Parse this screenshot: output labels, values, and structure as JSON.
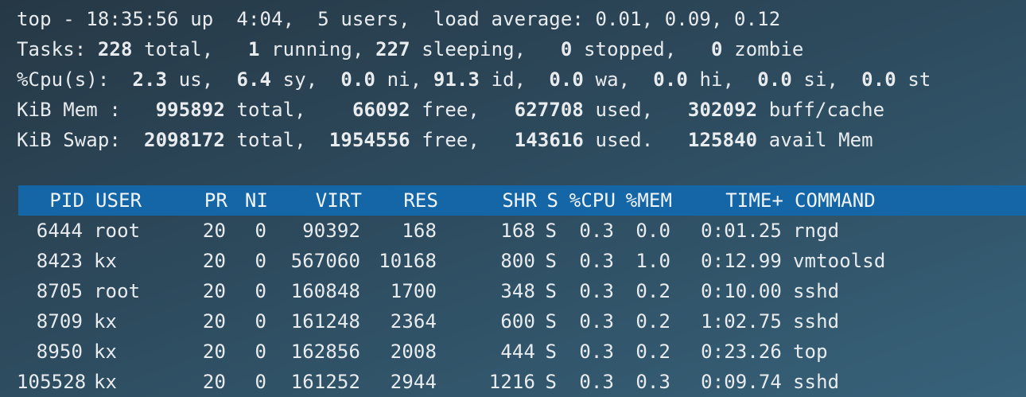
{
  "summary": {
    "line1": "top - 18:35:56 up  4:04,  5 users,  load average: 0.01, 0.09, 0.12",
    "tasks": {
      "prefix": "Tasks: ",
      "total": "228",
      "total_label": " total,   ",
      "running": "1",
      "running_label": " running, ",
      "sleeping": "227",
      "sleeping_label": " sleeping,   ",
      "stopped": "0",
      "stopped_label": " stopped,   ",
      "zombie": "0",
      "zombie_label": " zombie"
    },
    "cpu": {
      "prefix": "%Cpu(s):  ",
      "us": "2.3",
      "us_label": " us,  ",
      "sy": "6.4",
      "sy_label": " sy,  ",
      "ni": "0.0",
      "ni_label": " ni, ",
      "id": "91.3",
      "id_label": " id,  ",
      "wa": "0.0",
      "wa_label": " wa,  ",
      "hi": "0.0",
      "hi_label": " hi,  ",
      "si": "0.0",
      "si_label": " si,  ",
      "st": "0.0",
      "st_label": " st"
    },
    "mem": {
      "prefix": "KiB Mem :   ",
      "total": "995892",
      "total_label": " total,    ",
      "free": "66092",
      "free_label": " free,   ",
      "used": "627708",
      "used_label": " used,   ",
      "buff": "302092",
      "buff_label": " buff/cache"
    },
    "swap": {
      "prefix": "KiB Swap:  ",
      "total": "2098172",
      "total_label": " total,  ",
      "free": "1954556",
      "free_label": " free,   ",
      "used": "143616",
      "used_label": " used.   ",
      "avail": "125840",
      "avail_label": " avail Mem"
    }
  },
  "columns": {
    "pid": "PID",
    "user": "USER",
    "pr": "PR",
    "ni": "NI",
    "virt": "VIRT",
    "res": "RES",
    "shr": "SHR",
    "s": "S",
    "cpu": "%CPU",
    "mem": "%MEM",
    "time": "TIME+",
    "command": "COMMAND"
  },
  "processes": [
    {
      "pid": "6444",
      "user": "root",
      "pr": "20",
      "ni": "0",
      "virt": "90392",
      "res": "168",
      "shr": "168",
      "s": "S",
      "cpu": "0.3",
      "mem": "0.0",
      "time": "0:01.25",
      "command": "rngd"
    },
    {
      "pid": "8423",
      "user": "kx",
      "pr": "20",
      "ni": "0",
      "virt": "567060",
      "res": "10168",
      "shr": "800",
      "s": "S",
      "cpu": "0.3",
      "mem": "1.0",
      "time": "0:12.99",
      "command": "vmtoolsd"
    },
    {
      "pid": "8705",
      "user": "root",
      "pr": "20",
      "ni": "0",
      "virt": "160848",
      "res": "1700",
      "shr": "348",
      "s": "S",
      "cpu": "0.3",
      "mem": "0.2",
      "time": "0:10.00",
      "command": "sshd"
    },
    {
      "pid": "8709",
      "user": "kx",
      "pr": "20",
      "ni": "0",
      "virt": "161248",
      "res": "2364",
      "shr": "600",
      "s": "S",
      "cpu": "0.3",
      "mem": "0.2",
      "time": "1:02.75",
      "command": "sshd"
    },
    {
      "pid": "8950",
      "user": "kx",
      "pr": "20",
      "ni": "0",
      "virt": "162856",
      "res": "2008",
      "shr": "444",
      "s": "S",
      "cpu": "0.3",
      "mem": "0.2",
      "time": "0:23.26",
      "command": "top"
    },
    {
      "pid": "105528",
      "user": "kx",
      "pr": "20",
      "ni": "0",
      "virt": "161252",
      "res": "2944",
      "shr": "1216",
      "s": "S",
      "cpu": "0.3",
      "mem": "0.3",
      "time": "0:09.74",
      "command": "sshd"
    }
  ],
  "colors": {
    "background": "#2d4a5d",
    "header_bar": "#1566a6",
    "text": "#e8ecef"
  }
}
